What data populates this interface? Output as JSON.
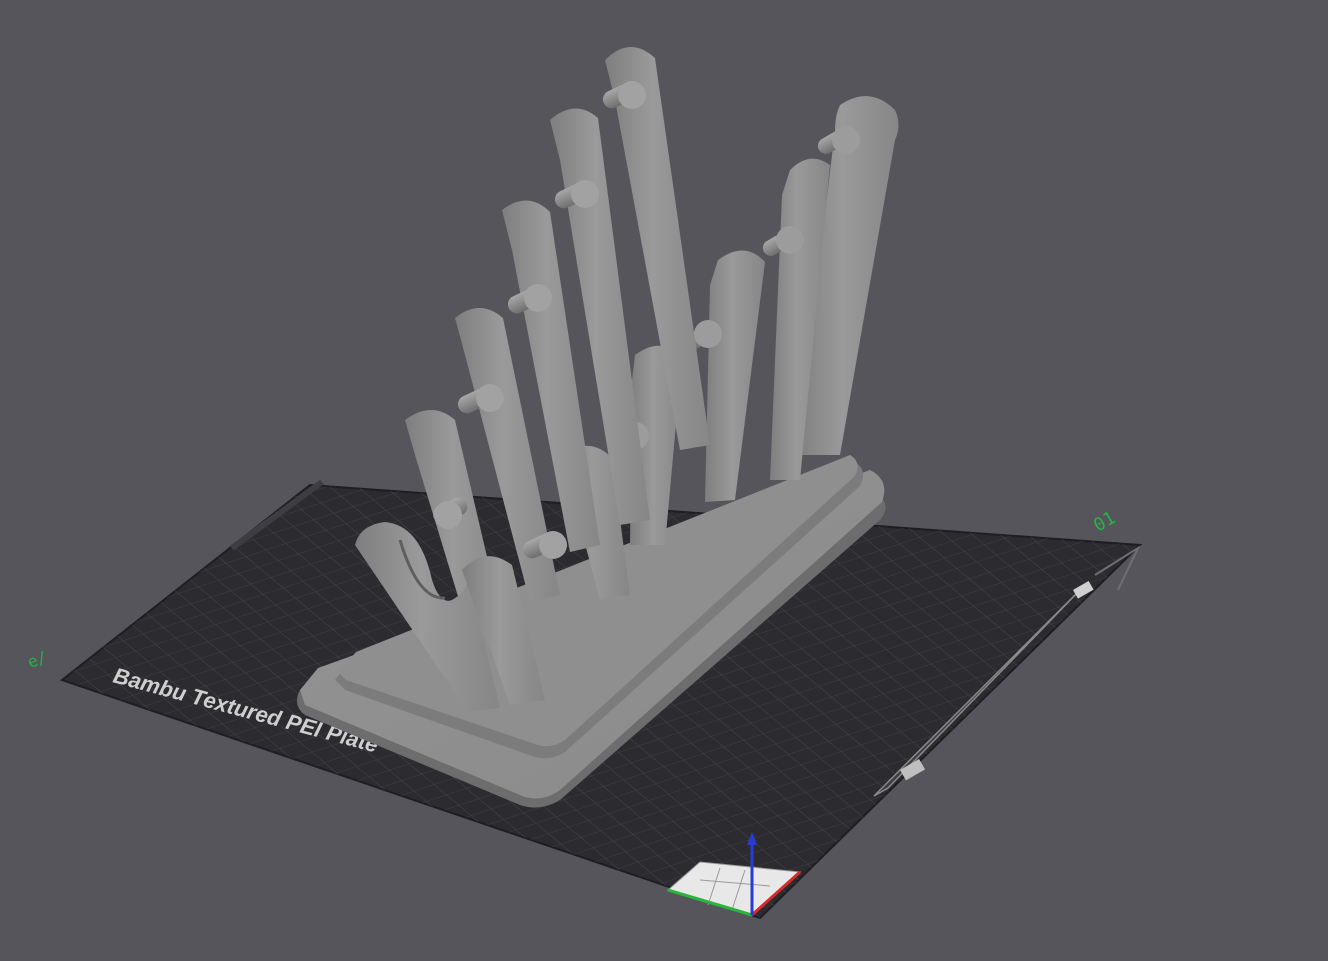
{
  "viewport": {
    "background_color": "#55555b",
    "plate_color": "#2c2c30",
    "grid_color": "#4a4a50",
    "model_color": "#8f8f8f",
    "plate_label": "Bambu Textured PEI Plate",
    "plate_number": "01",
    "edge_marker": "e/",
    "axis_colors": {
      "x": "#d42a2a",
      "y": "#2ab43c",
      "z": "#2a3ad4"
    }
  }
}
